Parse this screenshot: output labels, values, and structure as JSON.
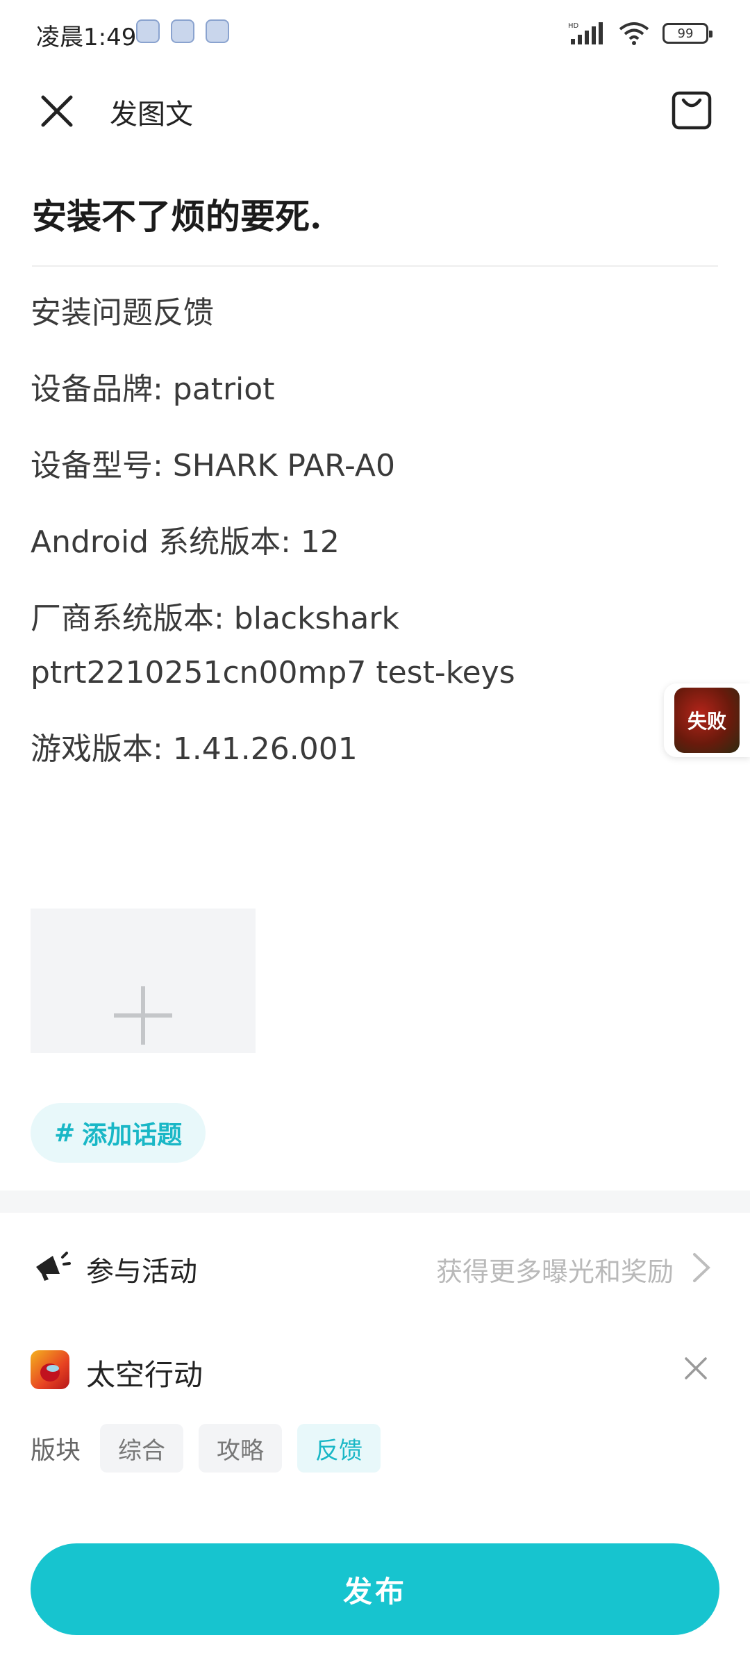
{
  "status_bar": {
    "time": "凌晨1:49",
    "network_label": "HD",
    "battery": "99"
  },
  "header": {
    "title": "发图文"
  },
  "post": {
    "title": "安装不了烦的要死.",
    "body_lines": [
      "安装问题反馈",
      "设备品牌: patriot",
      "设备型号: SHARK PAR-A0",
      "Android 系统版本: 12",
      "厂商系统版本: blackshark ptrt2210251cn00mp7 test-keys",
      "游戏版本: 1.41.26.001"
    ]
  },
  "float_badge": {
    "label": "失败"
  },
  "topic": {
    "label": "添加话题",
    "hash": "#"
  },
  "activity": {
    "label": "参与活动",
    "hint": "获得更多曝光和奖励"
  },
  "game": {
    "name": "太空行动"
  },
  "board": {
    "label": "版块",
    "options": [
      "综合",
      "攻略",
      "反馈"
    ],
    "selected": "反馈"
  },
  "publish": {
    "label": "发布"
  },
  "colors": {
    "accent": "#17c4cf",
    "accent_light": "#e8f8fa",
    "text": "#1f1f1f",
    "muted": "#b9b9b9"
  }
}
